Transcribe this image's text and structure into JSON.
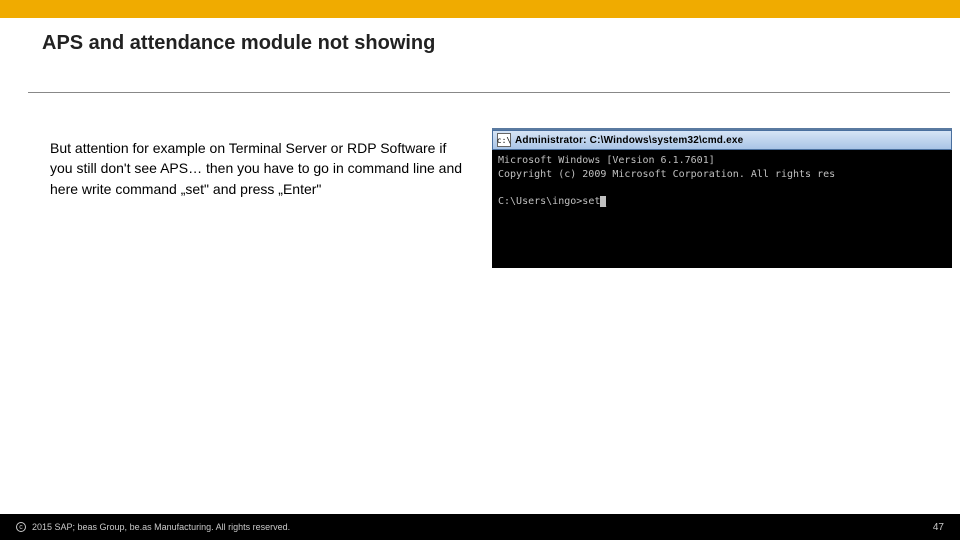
{
  "slide": {
    "title": "APS and attendance module not showing",
    "body": "But attention for example on Terminal Server or RDP Software if you still don't see  APS… then you have to go in command line and here write command „set\" and press „Enter\""
  },
  "cmd": {
    "windowTitle": "Administrator: C:\\Windows\\system32\\cmd.exe",
    "line1": "Microsoft Windows [Version 6.1.7601]",
    "line2": "Copyright (c) 2009 Microsoft Corporation. All rights res",
    "prompt": "C:\\Users\\ingo>",
    "typed": "set"
  },
  "footer": {
    "copyright": "2015 SAP; beas Group, be.as Manufacturing.  All rights reserved.",
    "page": "47"
  },
  "colors": {
    "accent": "#f0ab00"
  }
}
